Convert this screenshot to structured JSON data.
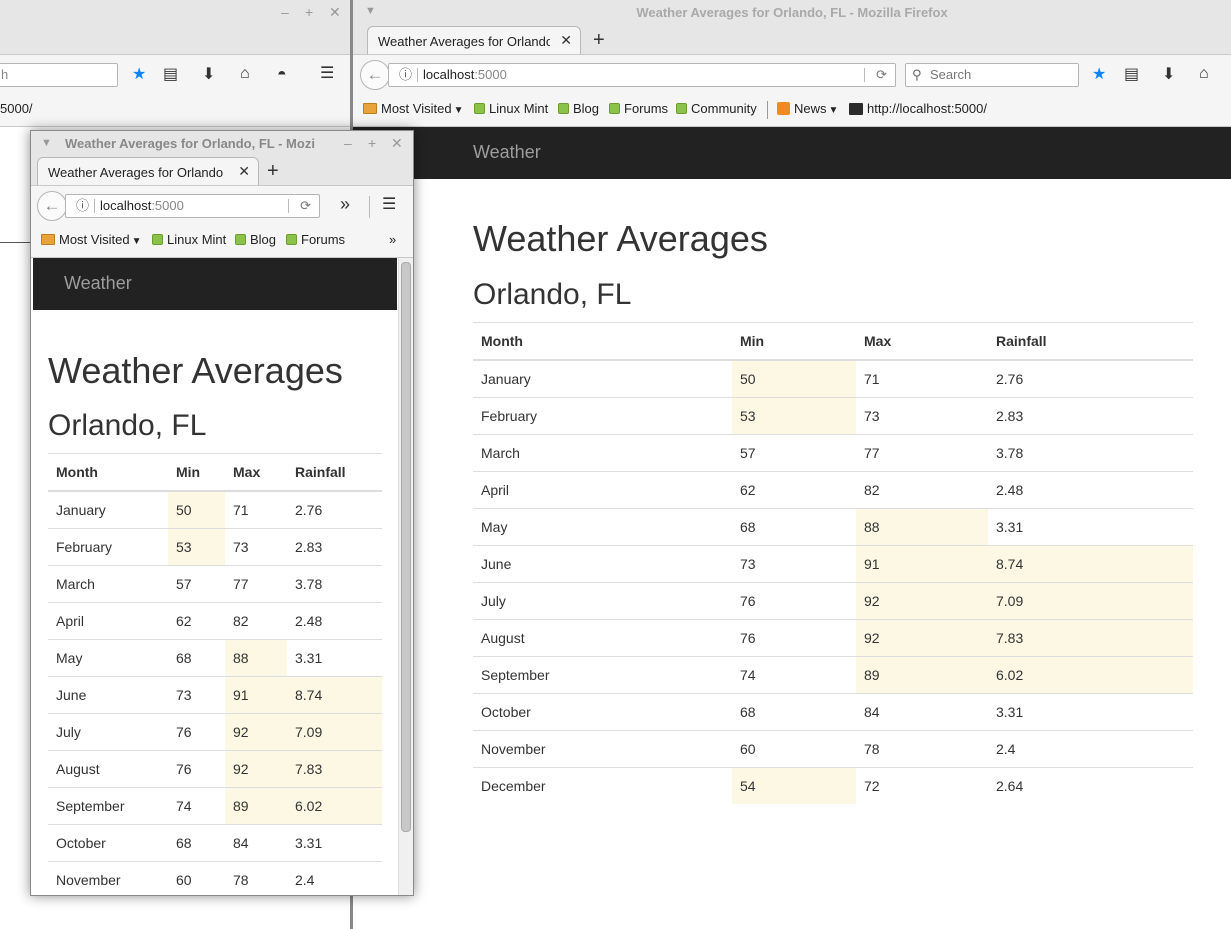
{
  "browser": {
    "window_title": "Weather Averages for Orlando, FL - Mozilla Firefox",
    "small_window_title": "Weather Averages for Orlando, FL - Mozi",
    "tab_title": "Weather Averages for Orlando, FL",
    "url_host": "localhost",
    "url_port": ":5000",
    "search_placeholder": "Search",
    "bg_url_fragment": "5000/",
    "bg_search_fragment": "h",
    "bookmarks": [
      "Most Visited",
      "Linux Mint",
      "Blog",
      "Forums",
      "Community",
      "News",
      "http://localhost:5000/"
    ],
    "overflow_chevron": "»"
  },
  "app": {
    "brand": "Weather",
    "heading": "Weather Averages",
    "subheading": "Orlando, FL"
  },
  "table": {
    "headers": [
      "Month",
      "Min",
      "Max",
      "Rainfall"
    ],
    "rows": [
      {
        "month": "January",
        "min": "50",
        "max": "71",
        "rain": "2.76",
        "hl": [
          "min"
        ]
      },
      {
        "month": "February",
        "min": "53",
        "max": "73",
        "rain": "2.83",
        "hl": [
          "min"
        ]
      },
      {
        "month": "March",
        "min": "57",
        "max": "77",
        "rain": "3.78",
        "hl": []
      },
      {
        "month": "April",
        "min": "62",
        "max": "82",
        "rain": "2.48",
        "hl": []
      },
      {
        "month": "May",
        "min": "68",
        "max": "88",
        "rain": "3.31",
        "hl": [
          "max"
        ]
      },
      {
        "month": "June",
        "min": "73",
        "max": "91",
        "rain": "8.74",
        "hl": [
          "max",
          "rain"
        ]
      },
      {
        "month": "July",
        "min": "76",
        "max": "92",
        "rain": "7.09",
        "hl": [
          "max",
          "rain"
        ]
      },
      {
        "month": "August",
        "min": "76",
        "max": "92",
        "rain": "7.83",
        "hl": [
          "max",
          "rain"
        ]
      },
      {
        "month": "September",
        "min": "74",
        "max": "89",
        "rain": "6.02",
        "hl": [
          "max",
          "rain"
        ]
      },
      {
        "month": "October",
        "min": "68",
        "max": "84",
        "rain": "3.31",
        "hl": []
      },
      {
        "month": "November",
        "min": "60",
        "max": "78",
        "rain": "2.4",
        "hl": []
      },
      {
        "month": "December",
        "min": "54",
        "max": "72",
        "rain": "2.64",
        "hl": [
          "min"
        ]
      }
    ],
    "small_visible_rows": 11
  },
  "colors": {
    "highlight": "#fcf8e3",
    "navbar_dark": "#222222",
    "brand_text": "#9d9d9d",
    "chrome": "#e6e6e6",
    "toolbar": "#f5f5f5",
    "star_blue": "#0a84ff"
  },
  "icons": [
    "back-arrow-icon",
    "info-icon",
    "reload-icon",
    "search-icon",
    "star-icon",
    "reading-list-icon",
    "download-icon",
    "home-icon",
    "pocket-icon",
    "menu-icon",
    "close-icon",
    "plus-icon",
    "minimize-icon",
    "maximize-icon",
    "chevron-down-icon",
    "rss-icon",
    "terminal-icon",
    "folder-icon",
    "linux-mint-icon"
  ]
}
